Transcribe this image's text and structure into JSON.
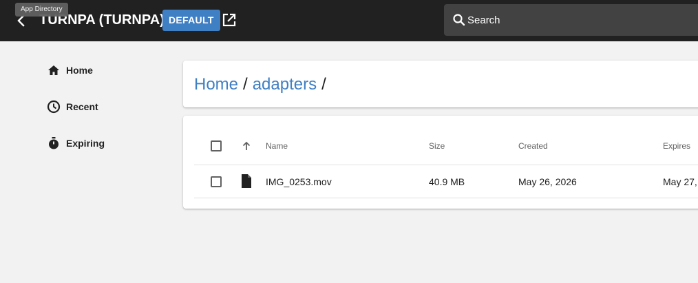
{
  "header": {
    "back_tooltip": "App Directory",
    "title": "TURNPA (TURNPA)",
    "badge": "DEFAULT",
    "search_placeholder": "Search"
  },
  "sidebar": {
    "items": [
      {
        "label": "Home",
        "icon": "home-icon"
      },
      {
        "label": "Recent",
        "icon": "clock-icon"
      },
      {
        "label": "Expiring",
        "icon": "stopwatch-icon"
      }
    ]
  },
  "breadcrumb": {
    "items": [
      "Home",
      "adapters"
    ],
    "separator": "/"
  },
  "table": {
    "columns": [
      "Name",
      "Size",
      "Created",
      "Expires"
    ],
    "rows": [
      {
        "name": "IMG_0253.mov",
        "size": "40.9 MB",
        "created": "May 26, 2026",
        "expires": "May 27,"
      }
    ]
  },
  "colors": {
    "topbar": "#212121",
    "accent": "#3f7fc4",
    "background": "#f2f2f2"
  }
}
